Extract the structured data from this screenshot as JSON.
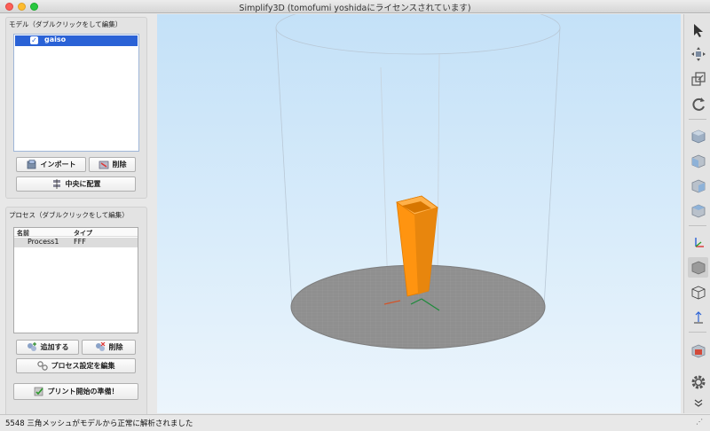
{
  "window": {
    "title": "Simplify3D (tomofumi yoshidaにライセンスされています)"
  },
  "models": {
    "section_title": "モデル（ダブルクリックをして編集）",
    "items": [
      {
        "name": "gaiso",
        "checked": true
      }
    ],
    "import_label": "インポート",
    "delete_label": "削除",
    "center_label": "中央に配置"
  },
  "processes": {
    "section_title": "プロセス（ダブルクリックをして編集）",
    "columns": [
      "名前",
      "タイプ"
    ],
    "rows": [
      {
        "name": "Process1",
        "type": "FFF"
      }
    ],
    "add_label": "追加する",
    "delete_label": "削除",
    "edit_label": "プロセス設定を編集"
  },
  "prepare_label": "プリント開始の準備！",
  "status": {
    "message": "5548 三角メッシュがモデルから正常に解析されました"
  },
  "colors": {
    "accent": "#2a62d6",
    "model": "#ff9410",
    "bed": "#8f8f8f",
    "sky": "#c4e1f8"
  },
  "toolbar": {
    "tools": [
      {
        "name": "select-tool-icon",
        "active": false
      },
      {
        "name": "move-tool-icon",
        "active": false
      },
      {
        "name": "scale-tool-icon",
        "active": false
      },
      {
        "name": "rotate-tool-icon",
        "active": false
      },
      {
        "name": "view-iso-cube-icon",
        "active": false
      },
      {
        "name": "view-front-cube-icon",
        "active": false
      },
      {
        "name": "view-side-cube-icon",
        "active": false
      },
      {
        "name": "view-top-cube-icon",
        "active": false
      },
      {
        "name": "show-axes-icon",
        "active": false
      },
      {
        "name": "solid-view-icon",
        "active": true
      },
      {
        "name": "wireframe-view-icon",
        "active": false
      },
      {
        "name": "build-volume-icon",
        "active": false
      },
      {
        "name": "cross-section-icon",
        "active": false
      },
      {
        "name": "settings-gear-icon",
        "active": false
      },
      {
        "name": "expand-chevron-icon",
        "active": false
      }
    ]
  }
}
